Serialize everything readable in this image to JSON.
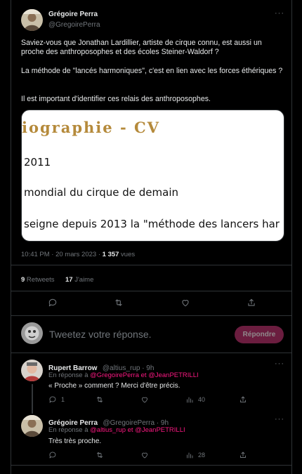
{
  "main_tweet": {
    "author_name": "Grégoire Perra",
    "author_handle": "@GregoirePerra",
    "para1": "Saviez-vous que Jonathan Lardillier, artiste de cirque connu, est aussi un proche des anthroposophes et des écoles Steiner-Waldorf ?",
    "para2": "La méthode de \"lancés harmoniques\", c'est en lien avec les forces éthériques ?",
    "para3": "Il est important d'identifier ces relais des anthroposophes.",
    "card": {
      "title": "iographie - CV",
      "line1": "2011",
      "line2": "mondial du cirque de demain",
      "line3": "seigne depuis 2013 la \"méthode des lancers har"
    },
    "timestamp": "10:41 PM · 20 mars 2023 · ",
    "views_count": "1 357",
    "views_label": " vues",
    "retweets_count": "9",
    "retweets_label": " Retweets",
    "likes_count": "17",
    "likes_label": " J'aime"
  },
  "compose": {
    "placeholder": "Tweetez votre réponse.",
    "button_label": "Répondre"
  },
  "replies": [
    {
      "author_name": "Rupert Barrow",
      "author_handle": "@altius_rup · 9h",
      "in_reply_prefix": "En réponse à ",
      "mention1": "@GregoirePerra",
      "and": " et ",
      "mention2": "@JeanPETRILLI",
      "text": "« Proche » comment ? Merci d'être précis.",
      "reply_count": "1",
      "views": "40"
    },
    {
      "author_name": "Grégoire Perra",
      "author_handle": "@GregoirePerra · 9h",
      "in_reply_prefix": "En réponse à ",
      "mention1": "@altius_rup",
      "and": " et ",
      "mention2": "@JeanPETRILLI",
      "text": "Très très proche.",
      "reply_count": "",
      "views": "28"
    }
  ],
  "colors": {
    "background": "#000000",
    "mention": "#f91880",
    "reply_button": "#6b1d3f",
    "card_title": "#b58a3b"
  }
}
